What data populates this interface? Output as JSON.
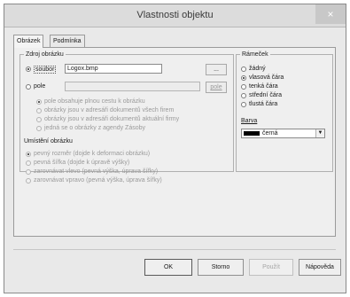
{
  "window": {
    "title": "Vlastnosti objektu",
    "close_glyph": "×"
  },
  "tabs": [
    {
      "label": "Obrázek",
      "active": true
    },
    {
      "label": "Podmínka",
      "active": false
    }
  ],
  "source": {
    "group_title": "Zdroj obrázku",
    "file_label": "soubor",
    "file_value": "Logox.bmp",
    "browse_label": "...",
    "field_label": "pole",
    "field_button_label": "pole",
    "options": [
      "pole obsahuje plnou cestu k obrázku",
      "obrázky jsou v adresáři dokumentů všech firem",
      "obrázky jsou v adresáři dokumentů aktuální firmy",
      "jedná se o obrázky z agendy Zásoby"
    ]
  },
  "placement": {
    "group_title": "Umístění obrázku",
    "options": [
      "pevný rozměr (dojde k deformaci obrázku)",
      "pevná šířka (dojde k úpravě výšky)",
      "zarovnávat vlevo (pevná výška, úprava šířky)",
      "zarovnávat vpravo (pevná výška, úprava šířky)"
    ]
  },
  "frame": {
    "group_title": "Rámeček",
    "options": [
      "žádný",
      "vlasová čára",
      "tenká čára",
      "střední čára",
      "tlustá čára"
    ],
    "selected_index": 1,
    "color_label": "Barva",
    "color_value": "černá",
    "color_swatch": "#000000"
  },
  "buttons": {
    "ok": "OK",
    "cancel": "Storno",
    "apply": "Použít",
    "help": "Nápověda"
  }
}
